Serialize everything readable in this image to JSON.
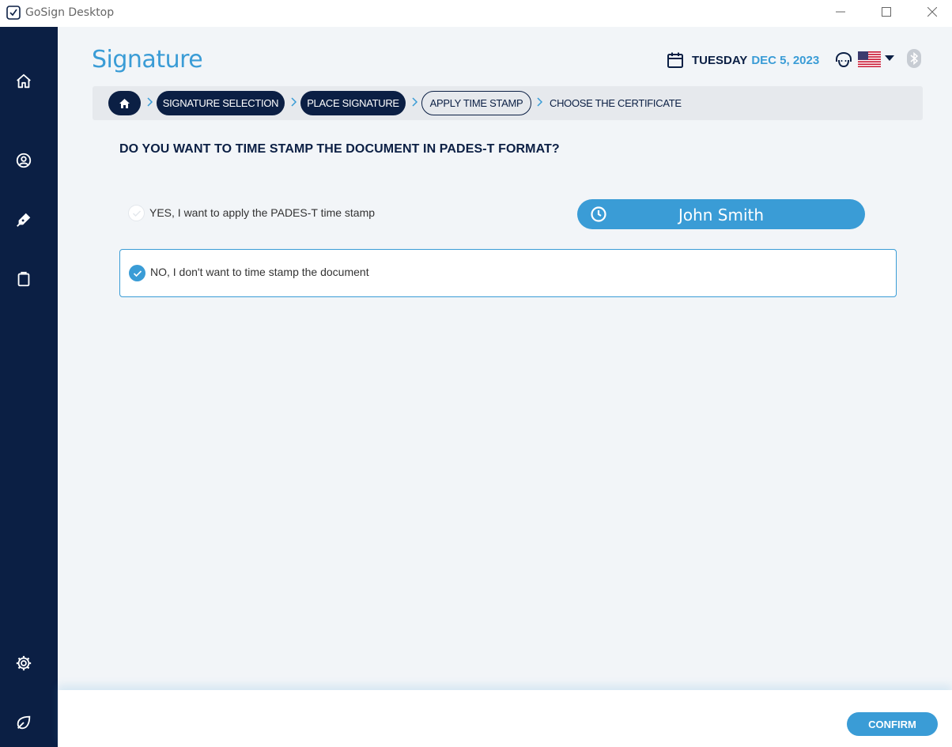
{
  "window": {
    "title": "GoSign Desktop"
  },
  "header": {
    "page_title": "Signature",
    "date_day": "TUESDAY",
    "date_value": "DEC 5, 2023"
  },
  "sidebar": {
    "items": [
      {
        "icon": "home-icon"
      },
      {
        "icon": "user-icon"
      },
      {
        "icon": "pen-icon"
      },
      {
        "icon": "clipboard-icon"
      },
      {
        "icon": "gear-icon"
      },
      {
        "icon": "leaf-icon"
      }
    ]
  },
  "breadcrumb": {
    "steps": [
      {
        "label": "SIGNATURE SELECTION",
        "state": "done"
      },
      {
        "label": "PLACE SIGNATURE",
        "state": "done"
      },
      {
        "label": "APPLY TIME STAMP",
        "state": "current"
      },
      {
        "label": "CHOOSE THE CERTIFICATE",
        "state": "pending"
      }
    ]
  },
  "question": "DO YOU WANT TO TIME STAMP THE DOCUMENT IN PADES-T FORMAT?",
  "options": {
    "yes_label": "YES, I want to apply the PADES-T time stamp",
    "no_label": "NO, I don't want to time stamp the document",
    "selected": "no"
  },
  "stamp_preview": {
    "name": "John Smith"
  },
  "footer": {
    "confirm_label": "CONFIRM"
  },
  "colors": {
    "navy": "#0b1f44",
    "accent": "#3a9cd6",
    "background": "#f2f5f8"
  }
}
